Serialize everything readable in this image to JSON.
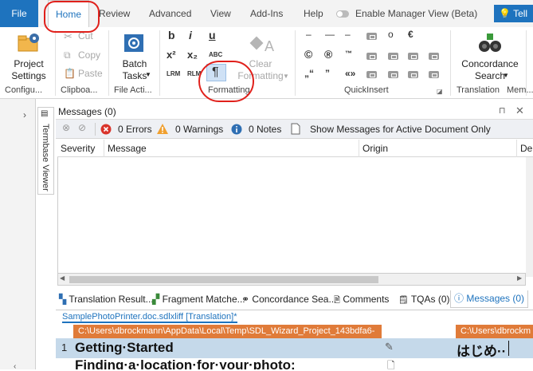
{
  "tabs": [
    "File",
    "Home",
    "Review",
    "Advanced",
    "View",
    "Add-Ins",
    "Help"
  ],
  "manager_toggle_label": "Enable Manager View (Beta)",
  "tell_label": "Tell",
  "ribbon": {
    "project_settings": "Project\nSettings",
    "cut": "Cut",
    "copy": "Copy",
    "paste": "Paste",
    "batch_tasks": "Batch\nTasks",
    "clear_formatting": "Clear\nFormatting",
    "concordance_search": "Concordance\nSearch",
    "glyphs_bold": "b",
    "glyphs_italic": "i",
    "glyphs_underline": "u",
    "sup": "x²",
    "sub": "x₂",
    "abc": "ABC",
    "lrm": "LRM",
    "rlm": "RLM",
    "pilcrow": "¶",
    "groups": [
      "Configu...",
      "Clipboa...",
      "File Acti...",
      "Formatting",
      "QuickInsert",
      "Translation",
      "Mem..."
    ],
    "quickinsert": [
      "–",
      "—",
      "–",
      "–",
      "o",
      "€",
      "©",
      "®",
      "™",
      "„“",
      "”",
      "«»"
    ]
  },
  "messages": {
    "title": "Messages (0)",
    "errors": "0 Errors",
    "warnings": "0 Warnings",
    "notes": "0 Notes",
    "show_active": "Show Messages for Active Document Only",
    "columns": [
      "Severity",
      "Message",
      "Origin",
      "De"
    ]
  },
  "termbase_viewer": "Termbase Viewer",
  "bottom_tabs": [
    "Translation Result...",
    "Fragment Matche...",
    "Concordance Sea...",
    "Comments",
    "TQAs (0)",
    "Messages (0)"
  ],
  "editor": {
    "file_tab": "SamplePhotoPrinter.doc.sdlxliff [Translation]*",
    "path_left": "C:\\Users\\dbrockmann\\AppData\\Local\\Temp\\SDL_Wizard_Project_143bdfa6-",
    "path_right": "C:\\Users\\dbrockm",
    "rows": [
      {
        "num": "1",
        "source": "Getting·Started",
        "target": "はじめ··"
      },
      {
        "num": "",
        "source": "Finding·a·location·for·your·photo:",
        "target": ""
      }
    ]
  },
  "colors": {
    "file_tab": "#1e73be",
    "annotation": "#e0201b",
    "path_bar": "#e07b39",
    "active_row": "#c5d9ea"
  }
}
